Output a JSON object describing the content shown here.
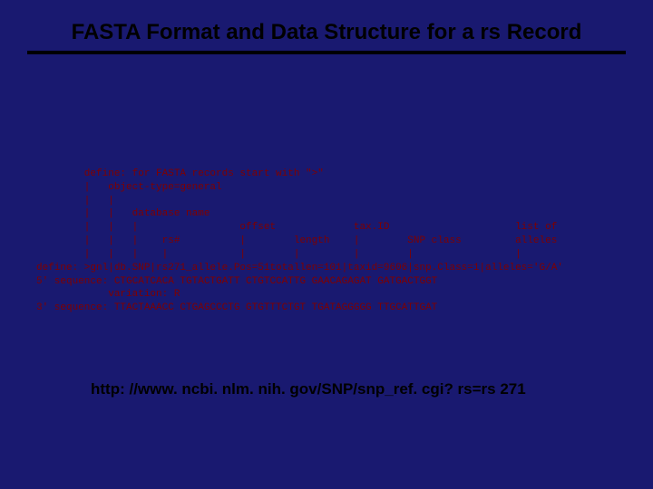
{
  "title": "FASTA Format and Data Structure for a rs Record",
  "code": {
    "l1": "        define: for FASTA records start with \">\"",
    "l2": "        |   object-type=general",
    "l3": "        |   |",
    "l4": "        |   |   database name",
    "l5": "        |   |   |                 offset             tax.ID                     list of",
    "l6": "        |   |   |    rs#          |        length    |        SNP class         alleles",
    "l7": "        |   |   |    |            |        |         |        |                 |",
    "l8": "define: >gnl|db.SNP|rs271_allele.Pos=51totallen=101|taxid=9606|snp.Class=1|alleles='G/A'",
    "l9": "5' sequence: CTGCATCACA TGTACTGATT CTGTCCATTG GAACAGAGAT GATGACTGGT",
    "l10": "            variation: R",
    "l11": "3' sequence: TTACTAAACC CTGAGCCCTG GTGTTTCTGT TGATAGGGGG TTGCATTGAT"
  },
  "url": "http: //www. ncbi. nlm. nih. gov/SNP/snp_ref. cgi? rs=rs 271"
}
